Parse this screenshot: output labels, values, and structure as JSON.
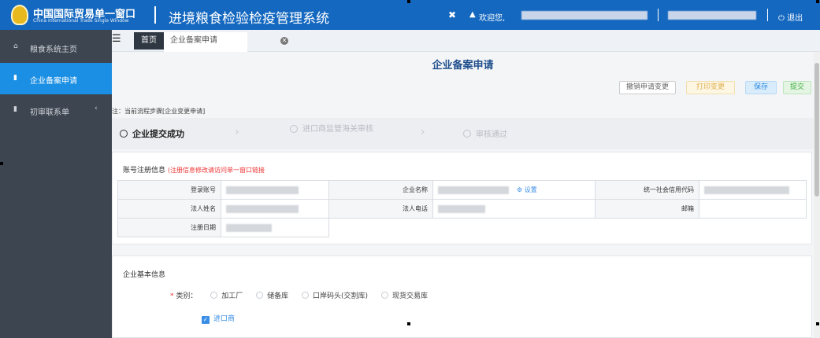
{
  "header": {
    "logo_cn": "中国国际贸易单一窗口",
    "logo_en": "China International Trade Single Window",
    "system_title": "进境粮食检验检疫管理系统",
    "welcome": "欢迎您,",
    "logout": "退出",
    "fullscreen_icon": "expand-icon",
    "user_icon": "user-icon"
  },
  "sidebar": {
    "items": [
      {
        "label": "粮食系统主页",
        "icon": "home-icon"
      },
      {
        "label": "企业备案申请",
        "icon": "document-icon",
        "active": true
      },
      {
        "label": "初审联系单",
        "icon": "list-icon",
        "expandable": true
      }
    ]
  },
  "tabs": {
    "home": "首页",
    "active": "企业备案申请"
  },
  "page": {
    "title": "企业备案申请",
    "buttons": {
      "cancel_change": "撤销申请变更",
      "print_change": "打印变更",
      "save": "保存",
      "submit": "提交"
    },
    "note": "注：当前流程步骤[企业变更申请]",
    "steps": [
      "企业提交成功",
      "进口商监管海关审核",
      "审核通过"
    ]
  },
  "account_info": {
    "title": "账号注册信息",
    "hint": "(注册信息修改请访问单一窗口链接",
    "labels": {
      "login_account": "登录账号",
      "company_name": "企业名称",
      "credit_code": "统一社会信用代码",
      "legal_name": "法人姓名",
      "legal_phone": "法人电话",
      "email": "邮箱",
      "register_date": "注册日期"
    },
    "setting_link": "设置"
  },
  "basic_info": {
    "title": "企业基本信息",
    "category_label": "类别：",
    "categories": [
      "加工厂",
      "储备库",
      "口岸码头(交割库)",
      "现货交易库"
    ],
    "importer_label": "进口商"
  },
  "colors": {
    "header_bg": "#1468c0",
    "sidebar_bg": "#3d4550",
    "sidebar_active": "#1a8fe3"
  }
}
